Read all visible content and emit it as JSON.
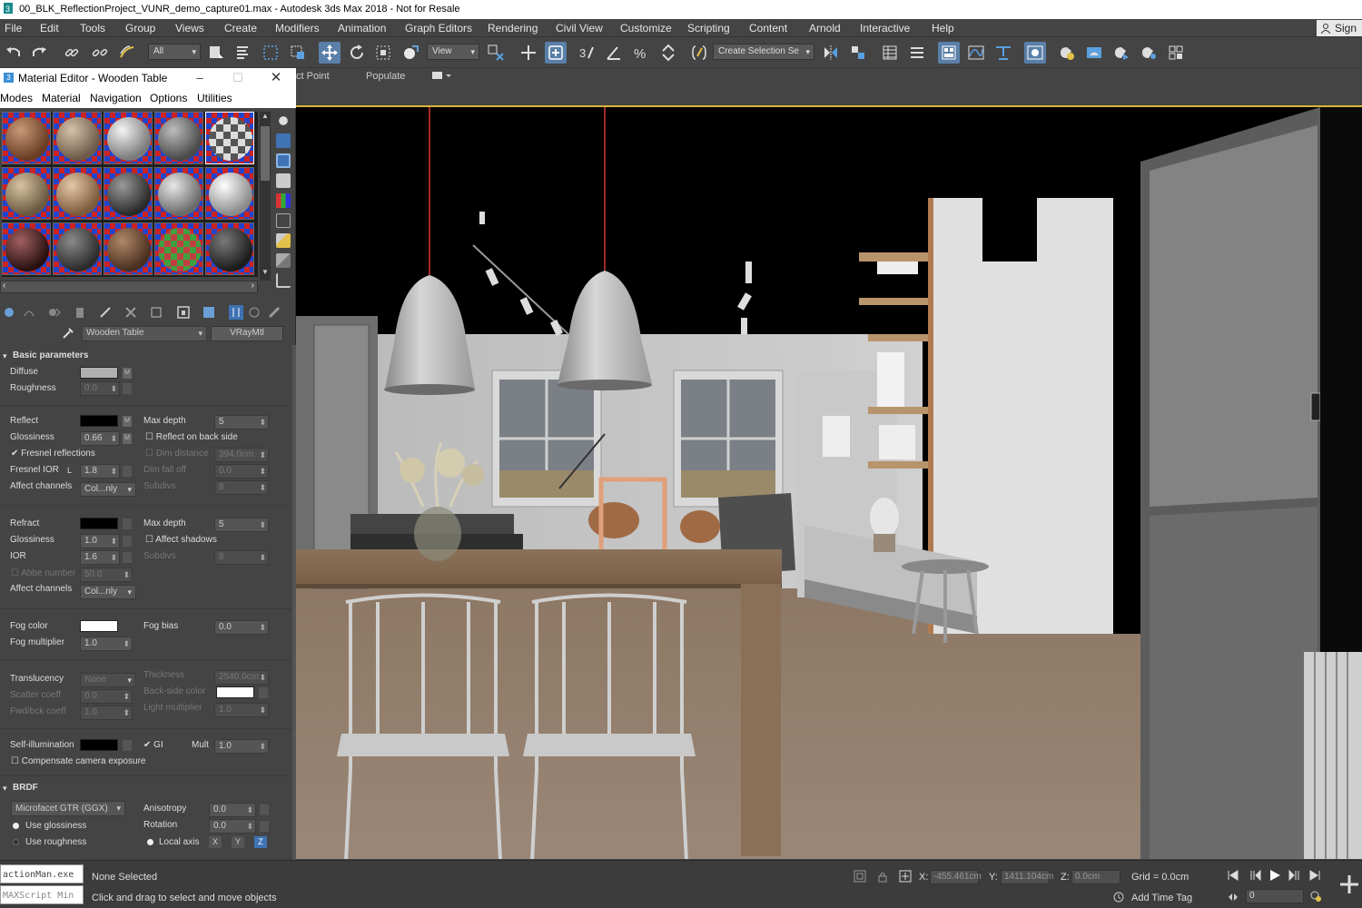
{
  "window": {
    "title": "00_BLK_ReflectionProject_VUNR_demo_capture01.max - Autodesk 3ds Max 2018 - Not for Resale"
  },
  "menubar": {
    "items": [
      "File",
      "Edit",
      "Tools",
      "Group",
      "Views",
      "Create",
      "Modifiers",
      "Animation",
      "Graph Editors",
      "Rendering",
      "Civil View",
      "Customize",
      "Scripting",
      "Content",
      "Arnold",
      "Interactive",
      "Help"
    ],
    "signin": "Sign"
  },
  "toolbar": {
    "selection_filter": "All",
    "reference_coord": "View",
    "named_selection": "Create Selection Se"
  },
  "ribbon": {
    "item1": "ct Point",
    "item2": "Populate"
  },
  "material_editor": {
    "title": "Material Editor - Wooden Table",
    "menu": [
      "Modes",
      "Material",
      "Navigation",
      "Options",
      "Utilities"
    ],
    "material_name": "Wooden Table",
    "material_type": "VRayMtl",
    "basic": {
      "header": "Basic parameters",
      "diffuse": "Diffuse",
      "roughness": "Roughness",
      "roughness_val": "0.0",
      "reflect": "Reflect",
      "max_depth": "Max depth",
      "max_depth_val": "5",
      "glossiness": "Glossiness",
      "glossiness_val": "0.66",
      "reflect_back": "Reflect on back side",
      "fresnel": "Fresnel reflections",
      "dim_distance": "Dim distance",
      "dim_distance_val": "394.0cm",
      "fresnel_ior": "Fresnel IOR",
      "fresnel_ior_lock": "L",
      "fresnel_ior_val": "1.8",
      "dim_falloff": "Dim fall off",
      "dim_falloff_val": "0.0",
      "affect_channels": "Affect channels",
      "affect_channels_val": "Col...nly",
      "subdivs": "Subdivs",
      "subdivs_val": "8",
      "refract": "Refract",
      "refr_max_depth": "Max depth",
      "refr_max_depth_val": "5",
      "refr_glossiness": "Glossiness",
      "refr_glossiness_val": "1.0",
      "affect_shadows": "Affect shadows",
      "ior": "IOR",
      "ior_val": "1.6",
      "refr_subdivs": "Subdivs",
      "refr_subdivs_val": "8",
      "abbe": "Abbe number",
      "abbe_val": "50.0",
      "refr_affect_channels": "Affect channels",
      "refr_affect_channels_val": "Col...nly",
      "fog_color": "Fog color",
      "fog_bias": "Fog bias",
      "fog_bias_val": "0.0",
      "fog_mult": "Fog multiplier",
      "fog_mult_val": "1.0",
      "translucency": "Translucency",
      "translucency_val": "None",
      "thickness": "Thickness",
      "thickness_val": "2540.0cm",
      "scatter": "Scatter coeff",
      "scatter_val": "0.0",
      "backside": "Back-side color",
      "fwdbck": "Fwd/bck coeff",
      "fwdbck_val": "1.0",
      "light_mult": "Light multiplier",
      "light_mult_val": "1.0",
      "self_illum": "Self-illumination",
      "gi": "GI",
      "mult": "Mult",
      "mult_val": "1.0",
      "compensate": "Compensate camera exposure"
    },
    "brdf": {
      "header": "BRDF",
      "type": "Microfacet GTR (GGX)",
      "anisotropy": "Anisotropy",
      "anisotropy_val": "0.0",
      "use_glossiness": "Use glossiness",
      "rotation": "Rotation",
      "rotation_val": "0.0",
      "use_roughness": "Use roughness",
      "local_axis": "Local axis",
      "ax_x": "X",
      "ax_y": "Y",
      "ax_z": "Z"
    }
  },
  "statusbar": {
    "maxscript1": "actionMan.exe",
    "maxscript2": "MAXScript Min",
    "selection": "None Selected",
    "prompt": "Click and drag to select and move objects",
    "x_label": "X:",
    "x_val": "-455.461cm",
    "y_label": "Y:",
    "y_val": "1411.104cm",
    "z_label": "Z:",
    "z_val": "0.0cm",
    "grid": "Grid = 0.0cm",
    "add_time_tag": "Add Time Tag",
    "frame": "0"
  },
  "colors": {
    "accent": "#3f73b4",
    "viewport_border": "#d9b633",
    "panel": "#444444"
  }
}
